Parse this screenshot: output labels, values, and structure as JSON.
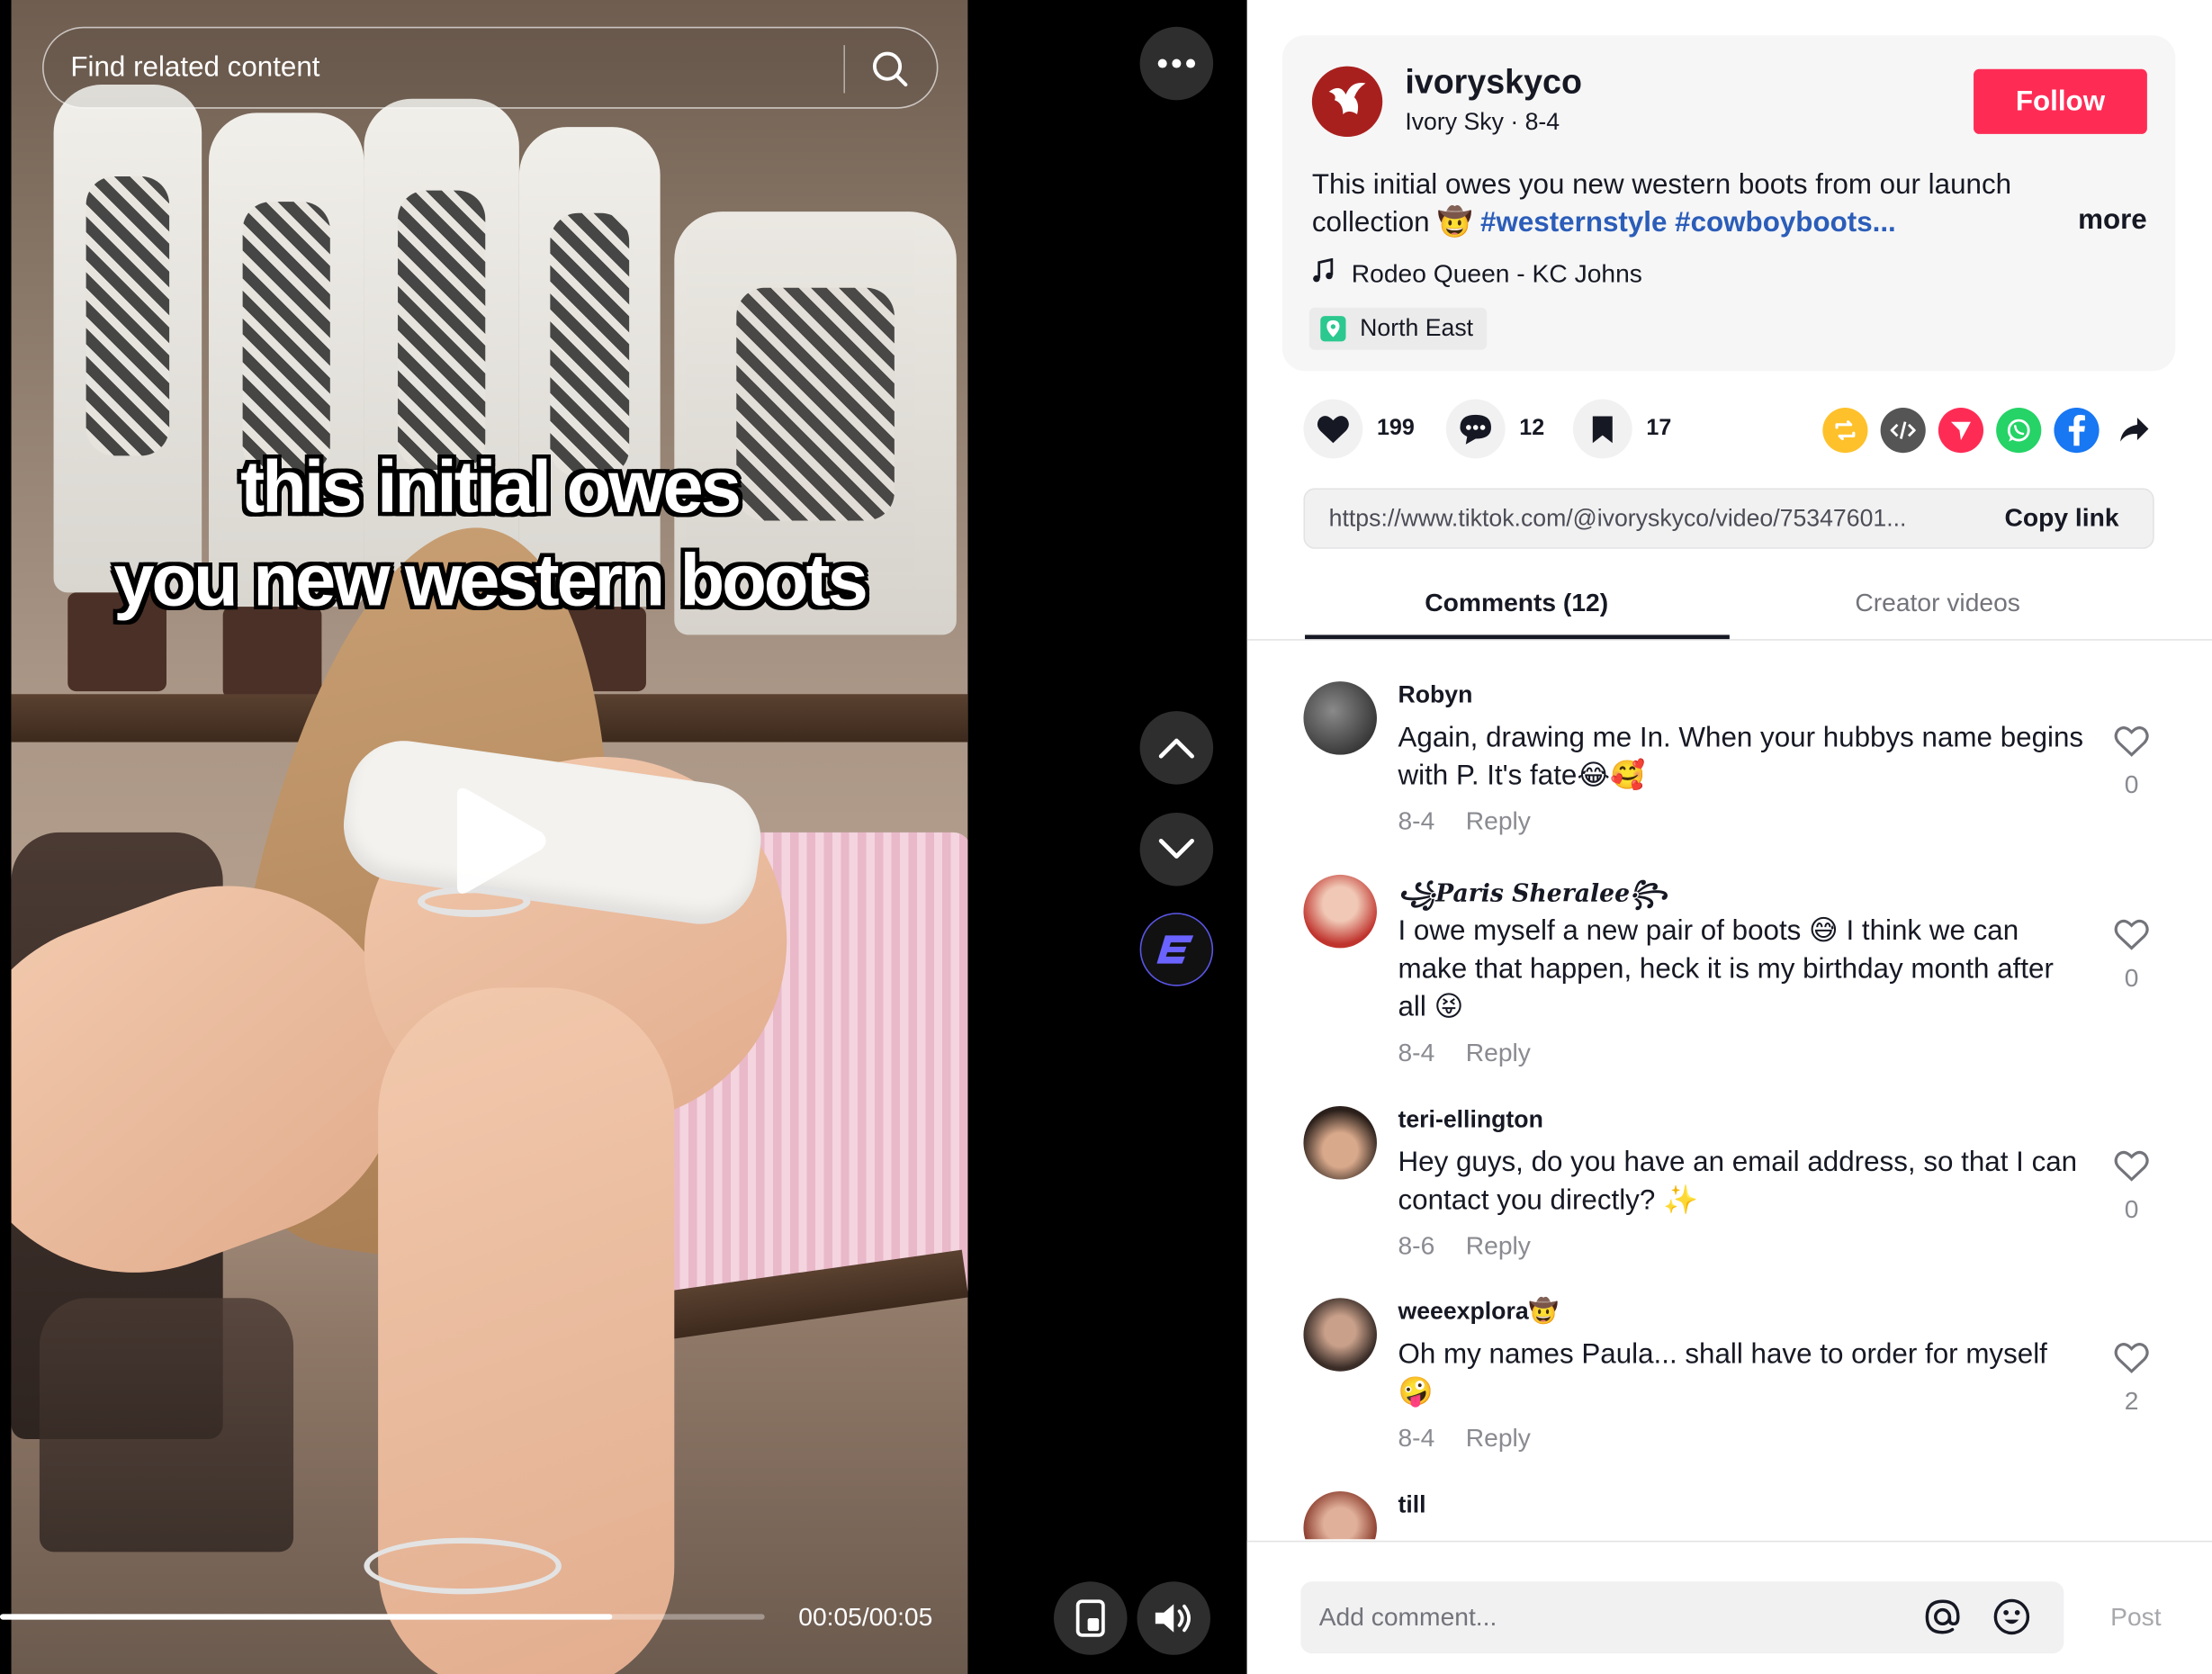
{
  "video": {
    "search_placeholder": "Find related content",
    "caption_line1": "this initial owes",
    "caption_line2": "you new western boots",
    "time": "00:05/00:05",
    "progress": 0.8
  },
  "post": {
    "username": "ivoryskyco",
    "display_name": "Ivory Sky",
    "date": "8-4",
    "follow_label": "Follow",
    "description_text": "This initial owes you new western boots from our launch collection 🤠 ",
    "hashtags": "#westernstyle #cowboyboots...",
    "more_label": "more",
    "music": "Rodeo Queen - KC Johns",
    "location": "North East",
    "likes": "199",
    "comments_count": "12",
    "saves": "17",
    "link": "https://www.tiktok.com/@ivoryskyco/video/75347601...",
    "copy_link_label": "Copy link"
  },
  "tabs": {
    "comments": "Comments (12)",
    "creator_videos": "Creator videos"
  },
  "comments": [
    {
      "name": "Robyn",
      "text": "Again, drawing me In. When your hubbys name begins with P. It's fate😂🥰",
      "date": "8-4",
      "reply": "Reply",
      "likes": "0"
    },
    {
      "name": "꧁Paris Sheralee꧂",
      "text": "I owe myself a new pair of boots 😅 I think we can make that happen, heck it is my birthday month after all 😝",
      "date": "8-4",
      "reply": "Reply",
      "likes": "0"
    },
    {
      "name": "teri-ellington",
      "text": "Hey guys, do you have an email address, so that I can contact you directly? ✨",
      "date": "8-6",
      "reply": "Reply",
      "likes": "0"
    },
    {
      "name": "weeexplora🤠",
      "text": "Oh my names Paula... shall have to order for myself 🤪",
      "date": "8-4",
      "reply": "Reply",
      "likes": "2"
    },
    {
      "name": "till",
      "text": "",
      "date": "",
      "reply": "",
      "likes": ""
    }
  ],
  "composer": {
    "placeholder": "Add comment...",
    "post_label": "Post"
  },
  "colors": {
    "accent": "#fe2c55",
    "hashtag": "#2b5db9",
    "repost": "#fec12b",
    "embed": "#555555",
    "send": "#fe2c55",
    "whatsapp": "#25d366",
    "facebook": "#1877f2"
  }
}
